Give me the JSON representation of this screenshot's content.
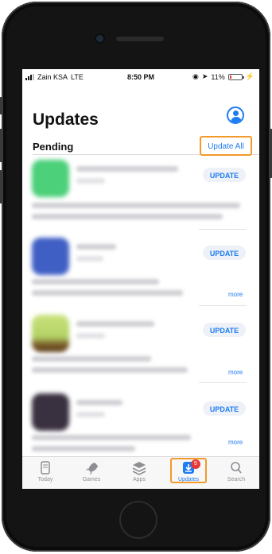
{
  "status": {
    "carrier": "Zain KSA",
    "network": "LTE",
    "time": "8:50 PM",
    "battery": "11%"
  },
  "header": {
    "title": "Updates"
  },
  "section": {
    "title": "Pending",
    "update_all_label": "Update All"
  },
  "apps": [
    {
      "button_label": "UPDATE",
      "icon_color": "#4cd07a",
      "more_label": ""
    },
    {
      "button_label": "UPDATE",
      "icon_color": "#3f5fc4",
      "more_label": "more"
    },
    {
      "button_label": "UPDATE",
      "icon_color": "#b9d96a",
      "more_label": "more"
    },
    {
      "button_label": "UPDATE",
      "icon_color": "#3a3140",
      "more_label": "more"
    }
  ],
  "tabbar": {
    "tabs": [
      {
        "label": "Today",
        "icon": "today-icon"
      },
      {
        "label": "Games",
        "icon": "rocket-icon"
      },
      {
        "label": "Apps",
        "icon": "layers-icon"
      },
      {
        "label": "Updates",
        "icon": "download-icon",
        "badge": "5"
      },
      {
        "label": "Search",
        "icon": "search-icon"
      }
    ]
  },
  "colors": {
    "accent": "#1d7cf2",
    "highlight": "#f39a2c",
    "badge": "#e53935"
  }
}
